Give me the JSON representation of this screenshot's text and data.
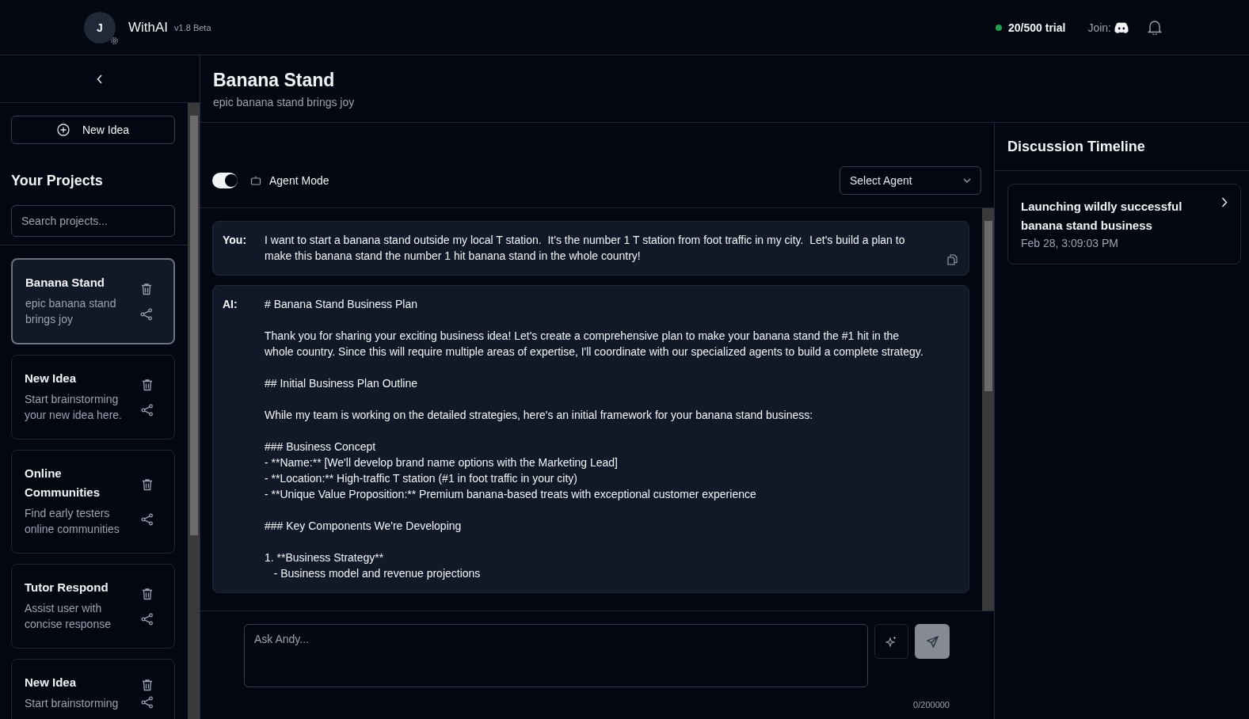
{
  "header": {
    "avatar_initial": "J",
    "app_name": "WithAI",
    "version": "v1.8 Beta",
    "trial": {
      "label": "20/500 trial",
      "color": "#22a050"
    },
    "join_label": "Join:"
  },
  "sidebar": {
    "new_button": "New Idea",
    "heading": "Your Projects",
    "search": {
      "placeholder": "Search projects..."
    },
    "projects": [
      {
        "title": "Banana Stand",
        "description": "epic banana stand brings joy",
        "selected": true
      },
      {
        "title": "New Idea",
        "description": "Start brainstorming your new idea here.",
        "selected": false
      },
      {
        "title": "Online Communities",
        "description": "Find early testers online communities",
        "selected": false
      },
      {
        "title": "Tutor Respond",
        "description": "Assist user with concise response",
        "selected": false
      },
      {
        "title": "New Idea",
        "description": "Start brainstorming",
        "selected": false
      }
    ]
  },
  "project": {
    "title": "Banana Stand",
    "subtitle": "epic banana stand brings joy"
  },
  "agent_mode": {
    "label": "Agent Mode",
    "on": true
  },
  "agent_select": {
    "placeholder": "Select Agent"
  },
  "messages": [
    {
      "speaker": "You:",
      "blocks": [
        [
          "I want to start a banana stand outside my local T station.  It's the number 1 T station from foot traffic in my city.  Let's build a plan to make this banana stand the number 1 hit banana stand in the whole country!"
        ]
      ],
      "copyable": true
    },
    {
      "speaker": "AI:",
      "blocks": [
        [
          "# Banana Stand Business Plan"
        ],
        [
          "Thank you for sharing your exciting business idea! Let's create a comprehensive plan to make your banana stand the #1 hit in the whole country. Since this will require multiple areas of expertise, I'll coordinate with our specialized agents to build a complete strategy."
        ],
        [
          "## Initial Business Plan Outline"
        ],
        [
          "While my team is working on the detailed strategies, here's an initial framework for your banana stand business:"
        ],
        [
          "### Business Concept",
          "- **Name:** [We'll develop brand name options with the Marketing Lead]",
          "- **Location:** High-traffic T station (#1 in foot traffic in your city)",
          "- **Unique Value Proposition:** Premium banana-based treats with exceptional customer experience"
        ],
        [
          "### Key Components We're Developing"
        ],
        [
          "1. **Business Strategy**",
          "   - Business model and revenue projections"
        ]
      ],
      "copyable": false
    }
  ],
  "composer": {
    "placeholder": "Ask Andy...",
    "counter": "0/200000"
  },
  "timeline": {
    "title": "Discussion Timeline",
    "entries": [
      {
        "title": "Launching wildly successful banana stand business",
        "time": "Feb 28, 3:09:03 PM"
      }
    ]
  }
}
